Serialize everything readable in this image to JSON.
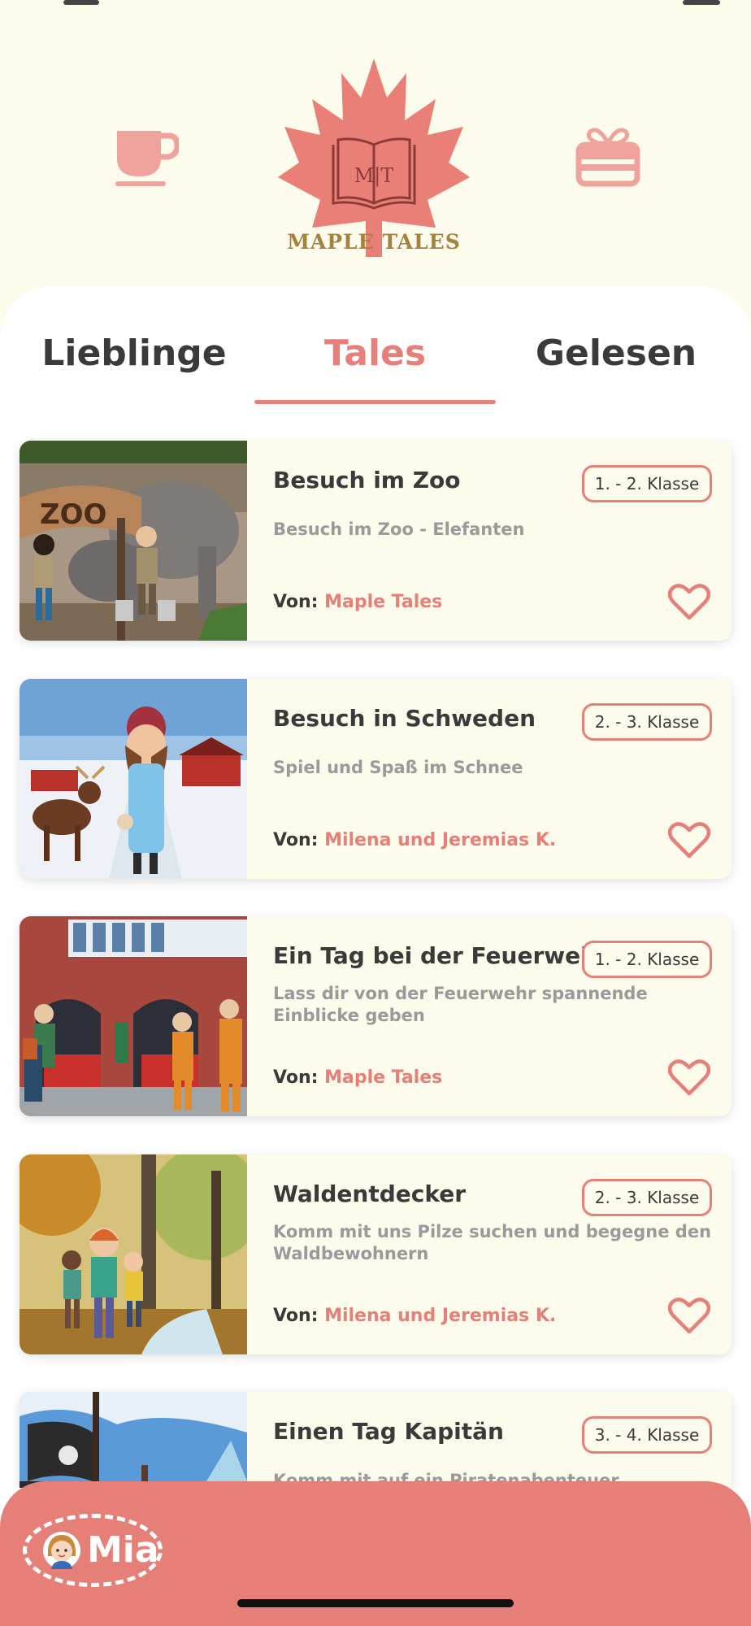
{
  "header": {
    "logo_text": "MAPLE TALES",
    "logo_monogram": "MT",
    "left_icon": "coffee-cup-icon",
    "right_icon": "gift-icon",
    "accent_color": "#e67f78"
  },
  "tabs": [
    {
      "label": "Lieblinge",
      "active": false
    },
    {
      "label": "Tales",
      "active": true
    },
    {
      "label": "Gelesen",
      "active": false
    }
  ],
  "author_prefix": "Von:",
  "stories": [
    {
      "title": "Besuch im Zoo",
      "grade": "1. - 2. Klasse",
      "subtitle": "Besuch im Zoo - Elefanten",
      "author": "Maple Tales",
      "image": "zoo-elephants",
      "sign_text": "ZOO"
    },
    {
      "title": "Besuch in Schweden",
      "grade": "2. - 3. Klasse",
      "subtitle": "Spiel und Spaß im Schnee",
      "author": "Milena und Jeremias K.",
      "image": "winter-sweden"
    },
    {
      "title": "Ein Tag bei der Feuerwehr",
      "grade": "1. - 2. Klasse",
      "subtitle": "Lass dir von der Feuerwehr spannende Einblicke geben",
      "author": "Maple Tales",
      "image": "fire-station"
    },
    {
      "title": "Waldentdecker",
      "grade": "2. - 3. Klasse",
      "subtitle": "Komm mit uns Pilze suchen und begegne den Waldbewohnern",
      "author": "Milena und Jeremias K.",
      "image": "autumn-forest"
    },
    {
      "title": "Einen Tag Kapitän",
      "grade": "3. - 4. Klasse",
      "subtitle": "Komm mit auf ein Piratenabenteuer",
      "author": "",
      "image": "pirate-ship"
    }
  ],
  "profile": {
    "name": "Mia",
    "avatar": "child-avatar-icon"
  }
}
